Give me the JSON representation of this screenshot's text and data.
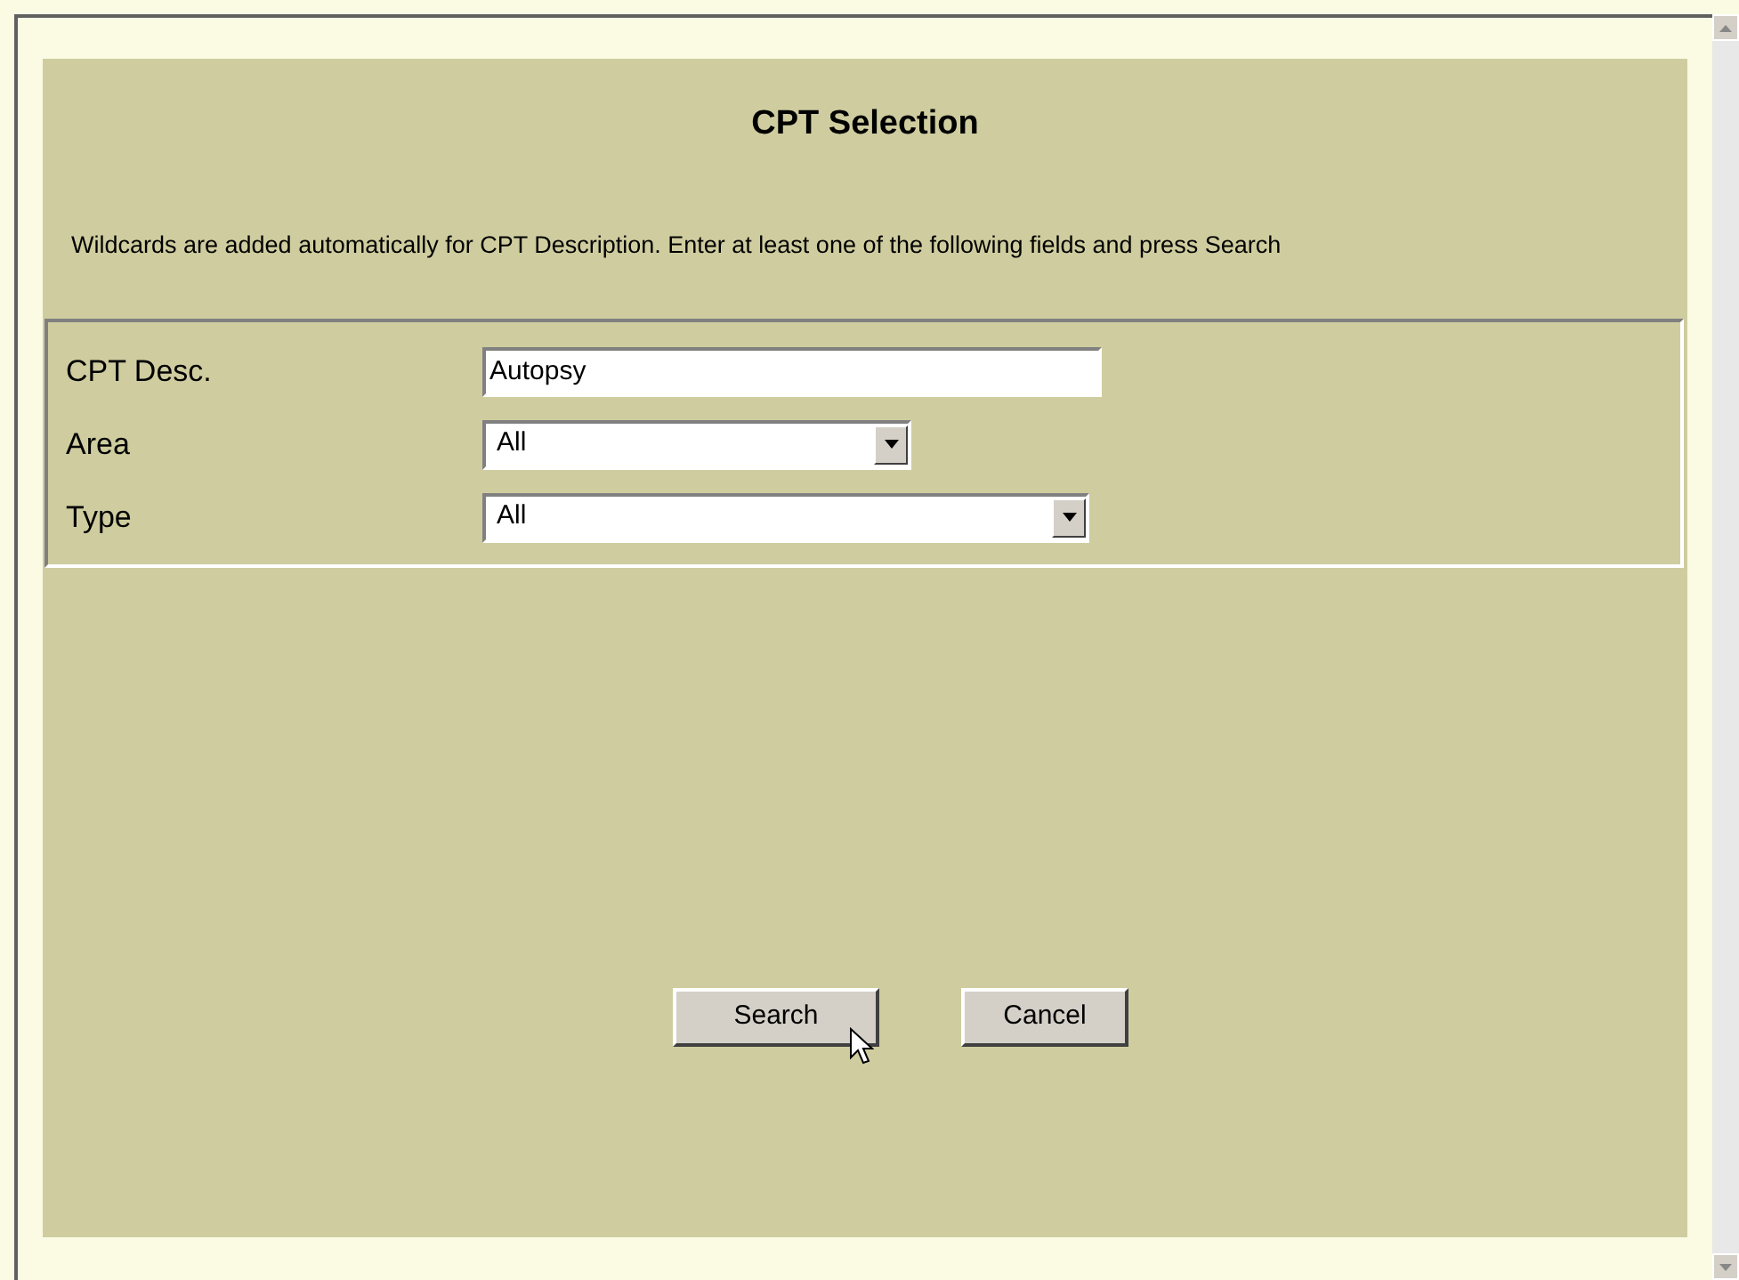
{
  "title": "CPT Selection",
  "instructions": "Wildcards are added automatically for CPT Description. Enter at least one of the following fields and press Search",
  "fields": [
    {
      "kind": "text",
      "label": "CPT Desc.",
      "value": "Autopsy"
    },
    {
      "kind": "select",
      "label": "Area",
      "value": "All"
    },
    {
      "kind": "select",
      "label": "Type",
      "value": "All"
    }
  ],
  "buttons": [
    "Search",
    "Cancel"
  ]
}
